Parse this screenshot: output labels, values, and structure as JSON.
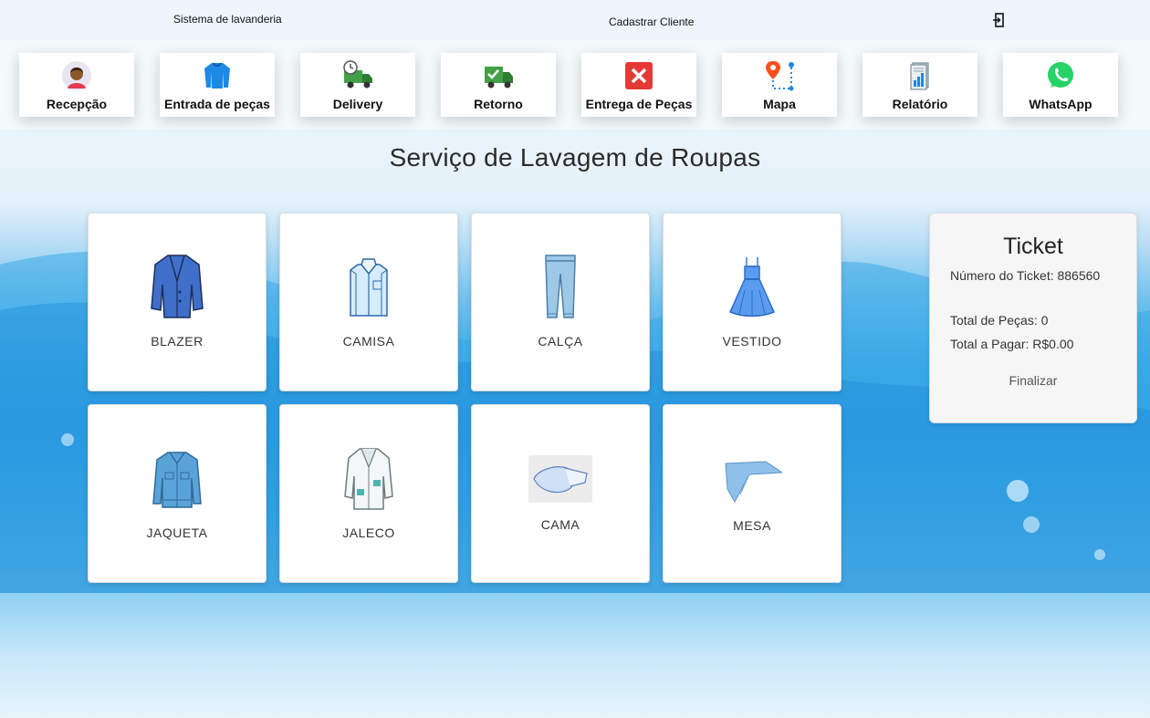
{
  "topbar": {
    "brand": "Sistema de lavanderia",
    "register_client": "Cadastrar Cliente",
    "logout_icon": "logout-icon"
  },
  "nav": {
    "items": [
      {
        "label": "Recepção",
        "icon": "user-avatar-icon"
      },
      {
        "label": "Entrada de peças",
        "icon": "sweater-icon"
      },
      {
        "label": "Delivery",
        "icon": "delivery-truck-clock-icon"
      },
      {
        "label": "Retorno",
        "icon": "truck-check-icon"
      },
      {
        "label": "Entrega de Peças",
        "icon": "red-x-icon"
      },
      {
        "label": "Mapa",
        "icon": "map-pin-icon"
      },
      {
        "label": "Relatório",
        "icon": "report-icon"
      },
      {
        "label": "WhatsApp",
        "icon": "whatsapp-icon"
      }
    ]
  },
  "page_title": "Serviço de Lavagem de Roupas",
  "products": [
    {
      "label": "BLAZER",
      "icon": "blazer-icon"
    },
    {
      "label": "CAMISA",
      "icon": "shirt-icon"
    },
    {
      "label": "CALÇA",
      "icon": "jeans-icon"
    },
    {
      "label": "VESTIDO",
      "icon": "dress-icon"
    },
    {
      "label": "JAQUETA",
      "icon": "denim-jacket-icon"
    },
    {
      "label": "JALECO",
      "icon": "lab-coat-icon"
    },
    {
      "label": "CAMA",
      "icon": "bed-linen-icon"
    },
    {
      "label": "MESA",
      "icon": "tablecloth-icon"
    }
  ],
  "ticket": {
    "title": "Ticket",
    "number_text": "Número do Ticket: 886560",
    "total_pieces_text": "Total de Peças: 0",
    "total_pay_text": "Total a Pagar: R$0.00",
    "finalize_label": "Finalizar"
  },
  "colors": {
    "accent_blue": "#2a9be3",
    "whatsapp_green": "#25d366",
    "truck_green": "#43a047",
    "cancel_red": "#e53935"
  }
}
